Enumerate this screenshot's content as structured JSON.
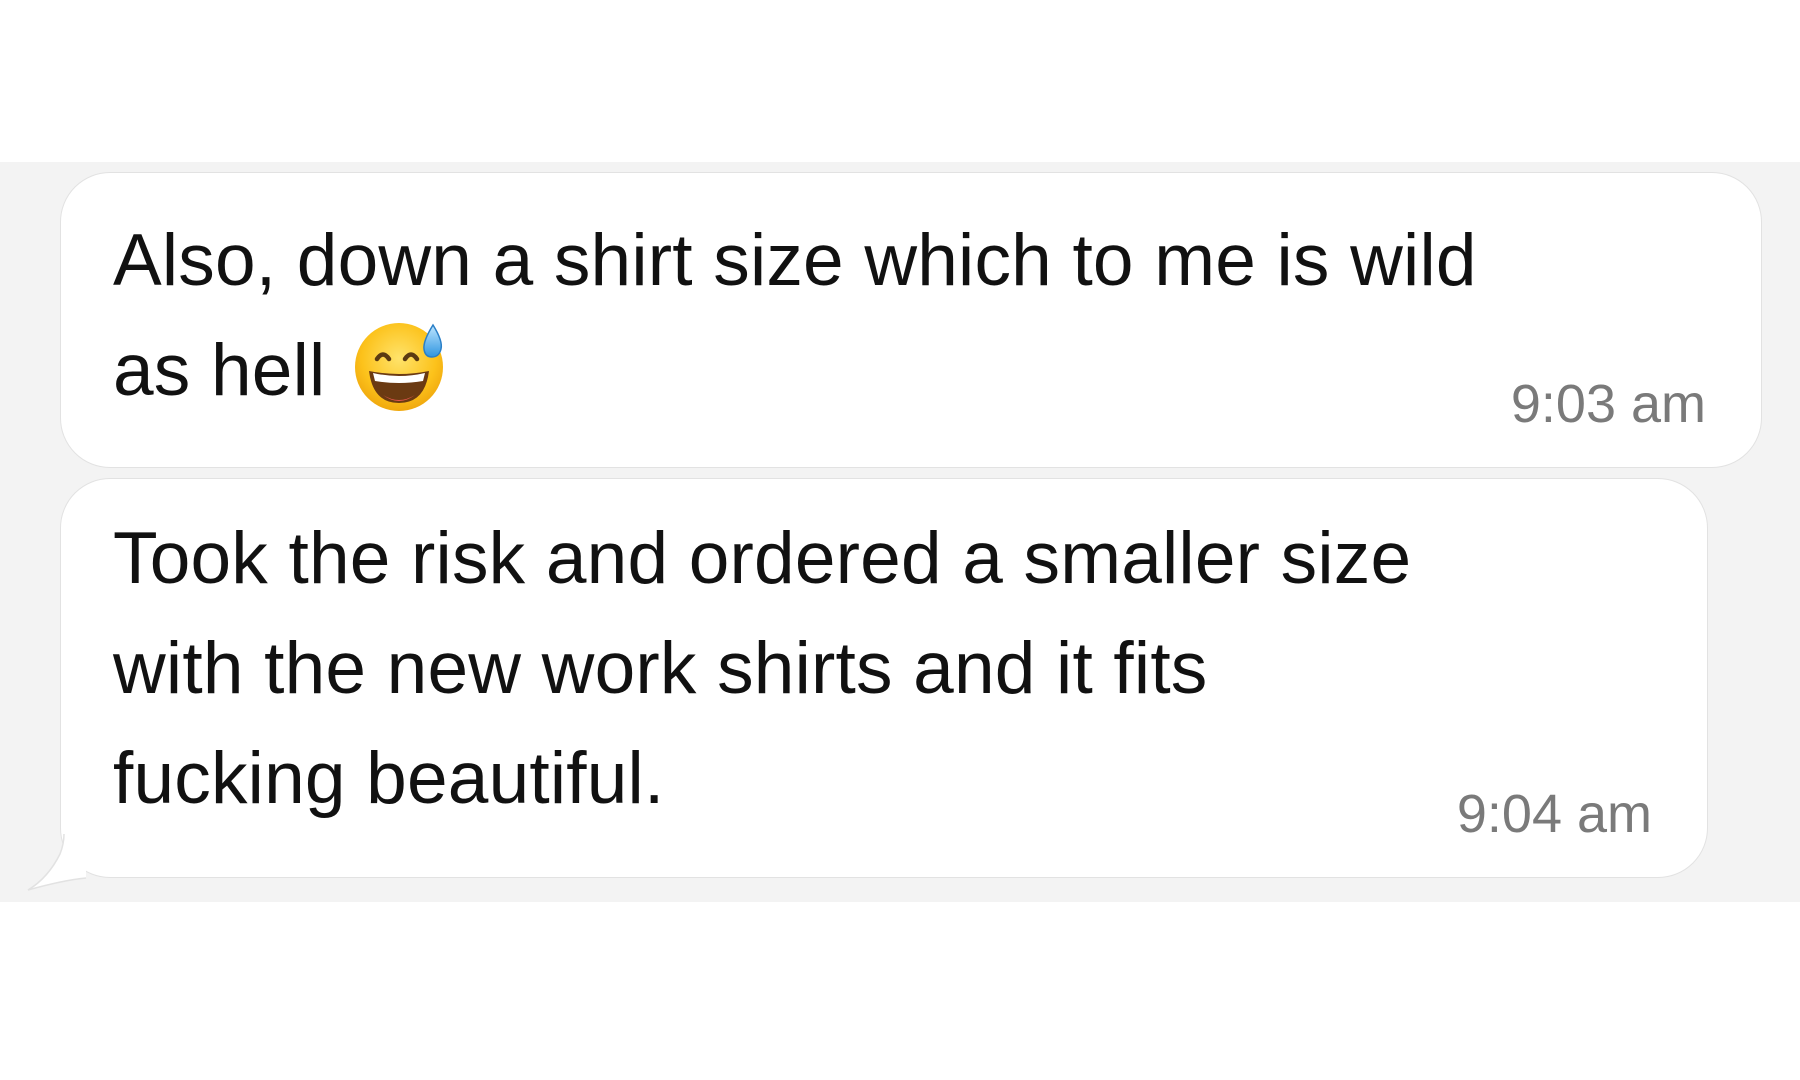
{
  "messages": [
    {
      "lines": [
        "Also, down a shirt size which to me is wild",
        "as hell"
      ],
      "emoji": "grinning-face-with-sweat-icon",
      "time": "9:03 am"
    },
    {
      "lines": [
        "Took the risk and ordered a smaller size",
        "with the new work shirts and it fits",
        "fucking beautiful."
      ],
      "time": "9:04 am"
    }
  ],
  "colors": {
    "background": "#f3f3f3",
    "bubble": "#ffffff",
    "text": "#111111",
    "timestamp": "#7a7a7a"
  }
}
